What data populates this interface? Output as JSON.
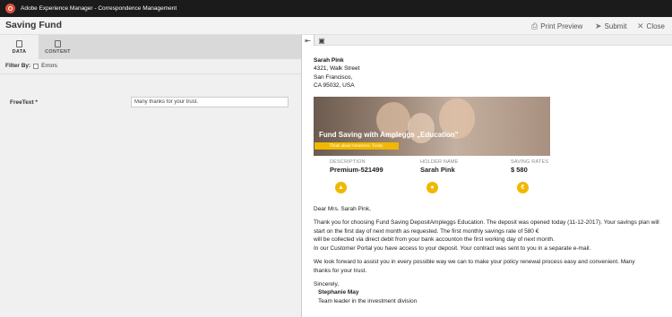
{
  "topbar": {
    "title": "Adobe Experience Manager - Correspondence Management"
  },
  "header": {
    "title": "Saving Fund",
    "print_preview": "Print Preview",
    "submit": "Submit",
    "close": "Close"
  },
  "tabs": [
    {
      "label": "DATA"
    },
    {
      "label": "CONTENT"
    }
  ],
  "filter": {
    "label": "Filter By:",
    "option": "Errors"
  },
  "form": {
    "freetext_label": "FreeText *",
    "freetext_value": "Many thanks for your trust."
  },
  "letter": {
    "address": [
      "Sarah Pink",
      "4321, Walk Street",
      "San Francisco,",
      "CA 95032, USA"
    ],
    "banner_title": "Fund Saving with Ampleggs „Education\"",
    "banner_sub": "Think about tomorrow. Today.",
    "columns": [
      {
        "label": "DESCRIPTION",
        "value": "Premium-521499",
        "icon": "graduation-cap-icon"
      },
      {
        "label": "HOLDER NAME",
        "value": "Sarah Pink",
        "icon": "person-icon"
      },
      {
        "label": "SAVING RATES",
        "value": "$ 580",
        "icon": "euro-icon"
      }
    ],
    "greeting": "Dear Mrs. Sarah Pink,",
    "para1": [
      "Thank you for choosing Fund Saving DepositAmpleggs Education. The deposit was opened today (11-12-2017). Your savings plan will",
      "start on the first day of next month as requested. The first monthly savings rate of 580 €",
      "will be collected via direct debit from your bank accounton the first working day of next month.",
      "In our Customer Portal you have access to your deposit. Your contract was sent to you in a separate e-mail."
    ],
    "para2": [
      "We look forward to assist you in every possible way we can to make your policy renewal process easy and convenient. Many",
      "thanks for your trust."
    ],
    "closing": "Sincerely,",
    "signer": "Stephanie May",
    "role": "Team leader in the investment division"
  }
}
